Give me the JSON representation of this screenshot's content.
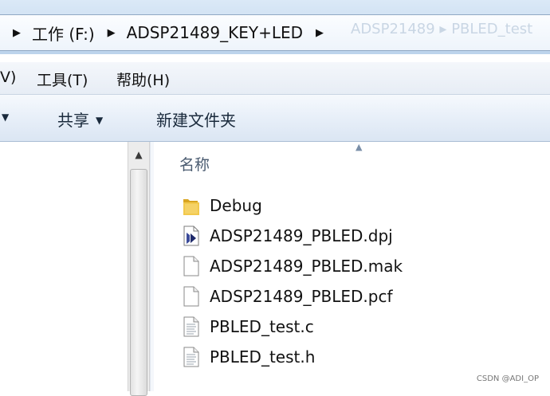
{
  "address_bar": {
    "segments": [
      "工作 (F:)",
      "ADSP21489_KEY+LED"
    ],
    "faded_text": "ADSP21489 ▸ PBLED_test"
  },
  "menu": {
    "items": [
      "V)",
      "工具(T)",
      "帮助(H)"
    ]
  },
  "toolbar": {
    "share_label": "共享",
    "new_folder_label": "新建文件夹"
  },
  "file_list": {
    "column_name_label": "名称",
    "files": [
      {
        "name": "Debug",
        "icon": "folder-icon"
      },
      {
        "name": "ADSP21489_PBLED.dpj",
        "icon": "project-file-icon"
      },
      {
        "name": "ADSP21489_PBLED.mak",
        "icon": "blank-file-icon"
      },
      {
        "name": "ADSP21489_PBLED.pcf",
        "icon": "blank-file-icon"
      },
      {
        "name": "PBLED_test.c",
        "icon": "text-file-icon"
      },
      {
        "name": "PBLED_test.h",
        "icon": "text-file-icon"
      }
    ]
  },
  "watermark": "CSDN @ADI_OP",
  "colors": {
    "folder": "#e8b838",
    "toolbar_bg": "#e6eef8",
    "address_border": "#8fa8c4"
  }
}
